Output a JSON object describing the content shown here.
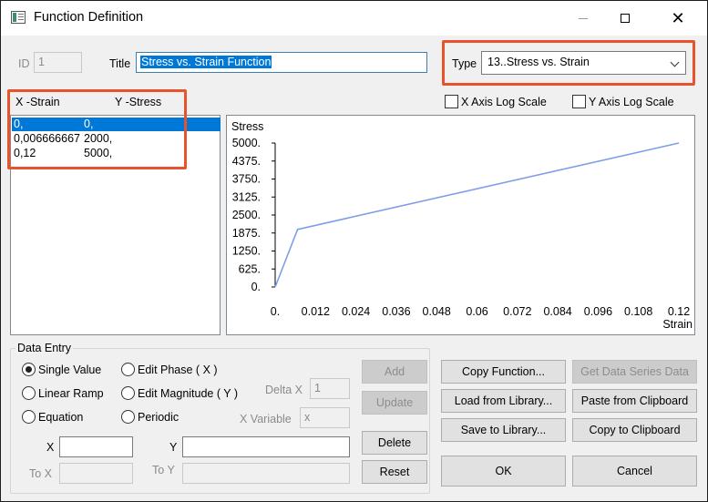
{
  "window": {
    "title": "Function Definition"
  },
  "form": {
    "id_label": "ID",
    "id_value": "1",
    "title_label": "Title",
    "title_value": "Stress vs. Strain Function",
    "type_label": "Type",
    "type_value": "13..Stress vs. Strain"
  },
  "list": {
    "header_x": "X -Strain",
    "header_y": "Y -Stress",
    "rows": [
      {
        "x": "0,",
        "y": "0,"
      },
      {
        "x": "0,006666667",
        "y": "2000,"
      },
      {
        "x": "0,12",
        "y": "5000,"
      }
    ]
  },
  "options": {
    "x_log_label": "X Axis Log Scale",
    "y_log_label": "Y Axis Log Scale",
    "x_log_checked": false,
    "y_log_checked": false
  },
  "chart_data": {
    "type": "line",
    "title": "",
    "xlabel": "Strain",
    "ylabel": "Stress",
    "x_ticks": [
      "0.",
      "0.012",
      "0.024",
      "0.036",
      "0.048",
      "0.06",
      "0.072",
      "0.084",
      "0.096",
      "0.108",
      "0.12"
    ],
    "y_ticks": [
      "0.",
      "625.",
      "1250.",
      "1875.",
      "2500.",
      "3125.",
      "3750.",
      "4375.",
      "5000."
    ],
    "xlim": [
      0,
      0.12
    ],
    "ylim": [
      0,
      5000
    ],
    "grid": false,
    "line_color": "#7f9ee8",
    "series": [
      {
        "x": [
          0,
          0.006666667,
          0.12
        ],
        "y": [
          0,
          2000,
          5000
        ]
      }
    ]
  },
  "data_entry": {
    "legend": "Data Entry",
    "radios": {
      "single_value": "Single Value",
      "linear_ramp": "Linear Ramp",
      "equation": "Equation",
      "edit_phase": "Edit Phase ( X )",
      "edit_magnitude": "Edit Magnitude ( Y )",
      "periodic": "Periodic"
    },
    "selected": "single_value",
    "delta_x_label": "Delta X",
    "delta_x_value": "1",
    "x_variable_label": "X Variable",
    "x_variable_value": "x",
    "x_label": "X",
    "x_value": "",
    "y_label": "Y",
    "y_value": "",
    "to_x_label": "To X",
    "to_y_label": "To Y",
    "add_label": "Add",
    "update_label": "Update",
    "delete_label": "Delete",
    "reset_label": "Reset"
  },
  "buttons": {
    "copy_function": "Copy Function...",
    "get_data_series": "Get Data Series Data",
    "load_library": "Load from Library...",
    "paste_clipboard": "Paste from Clipboard",
    "save_library": "Save to Library...",
    "copy_clipboard": "Copy to Clipboard",
    "ok": "OK",
    "cancel": "Cancel"
  },
  "colors": {
    "highlight": "#e8532b",
    "selection": "#0078d7"
  }
}
